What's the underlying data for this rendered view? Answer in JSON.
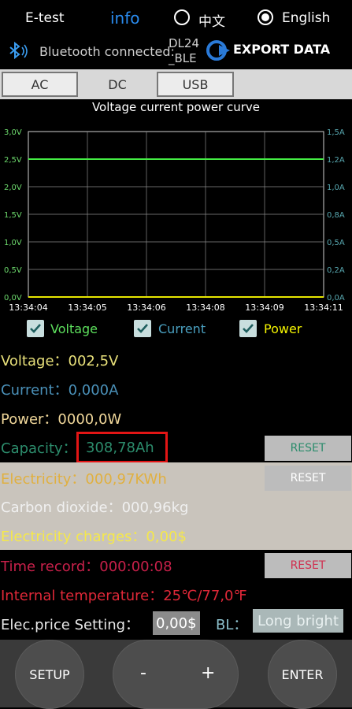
{
  "header": {
    "app_title": "E-test",
    "info_label": "info",
    "lang_options": [
      "中文",
      "English"
    ],
    "lang_selected": "English",
    "bt_status": "Bluetooth connected:",
    "device_name_line1": "DL24",
    "device_name_line2": "_BLE",
    "export_label": "EXPORT DATA"
  },
  "tabs": [
    "AC",
    "DC",
    "USB"
  ],
  "active_tab": "DC",
  "chart_data": {
    "type": "line",
    "title": "Voltage current power curve",
    "x": [
      "13:34:04",
      "13:34:05",
      "13:34:06",
      "13:34:08",
      "13:34:09",
      "13:34:11"
    ],
    "left_ticks": [
      "3,0V",
      "2,5V",
      "2,0V",
      "1,5V",
      "1,0V",
      "0,5V",
      "0,0V"
    ],
    "right_ticks": [
      "1,5A",
      "1,2A",
      "1,0A",
      "0,8A",
      "0,5A",
      "0,2A",
      "0,0A"
    ],
    "ylim_left": [
      0,
      3.0
    ],
    "ylim_right": [
      0,
      1.5
    ],
    "grid": true,
    "series": [
      {
        "name": "Voltage",
        "axis": "left",
        "color": "#44ee44",
        "values": [
          2.5,
          2.5,
          2.5,
          2.5,
          2.5,
          2.5
        ]
      },
      {
        "name": "Current",
        "axis": "right",
        "color": "#e6e600",
        "values": [
          0,
          0,
          0,
          0,
          0,
          0
        ]
      }
    ]
  },
  "legend": {
    "voltage": "Voltage",
    "current": "Current",
    "power": "Power",
    "colors": {
      "voltage": "#5de05d",
      "current": "#4aa0c0",
      "power": "#f5f500"
    }
  },
  "readings": {
    "voltage": "Voltage：002,5V",
    "current": "Current：0,000A",
    "power": "Power：0000,0W",
    "capacity_label": "Capacity：",
    "capacity_value": "308,78Ah",
    "electricity": "Electricity：000,97KWh",
    "co2": "Carbon dioxide：000,96kg",
    "charges": "Electricity charges：0,00$",
    "time_record": "Time record：000:00:08",
    "temperature": "Internal temperature：25℃/77,0℉",
    "price_label": "Elec.price Setting：",
    "price_value": "0,00$",
    "bl_label": "BL：",
    "bl_value": "Long bright"
  },
  "reset_label": "RESET",
  "buttons": {
    "setup": "SETUP",
    "minus": "-",
    "plus": "+",
    "enter": "ENTER"
  },
  "colors": {
    "voltage_text": "#e8e07a",
    "current_text": "#4a90b8",
    "power_text": "#f0d79a",
    "capacity_text": "#2c8c6c",
    "electricity_text": "#e0b040",
    "co2_text": "#f0f0f0",
    "charges_text": "#f5e84a",
    "time_text": "#c8204a",
    "temp_text": "#e02838"
  }
}
